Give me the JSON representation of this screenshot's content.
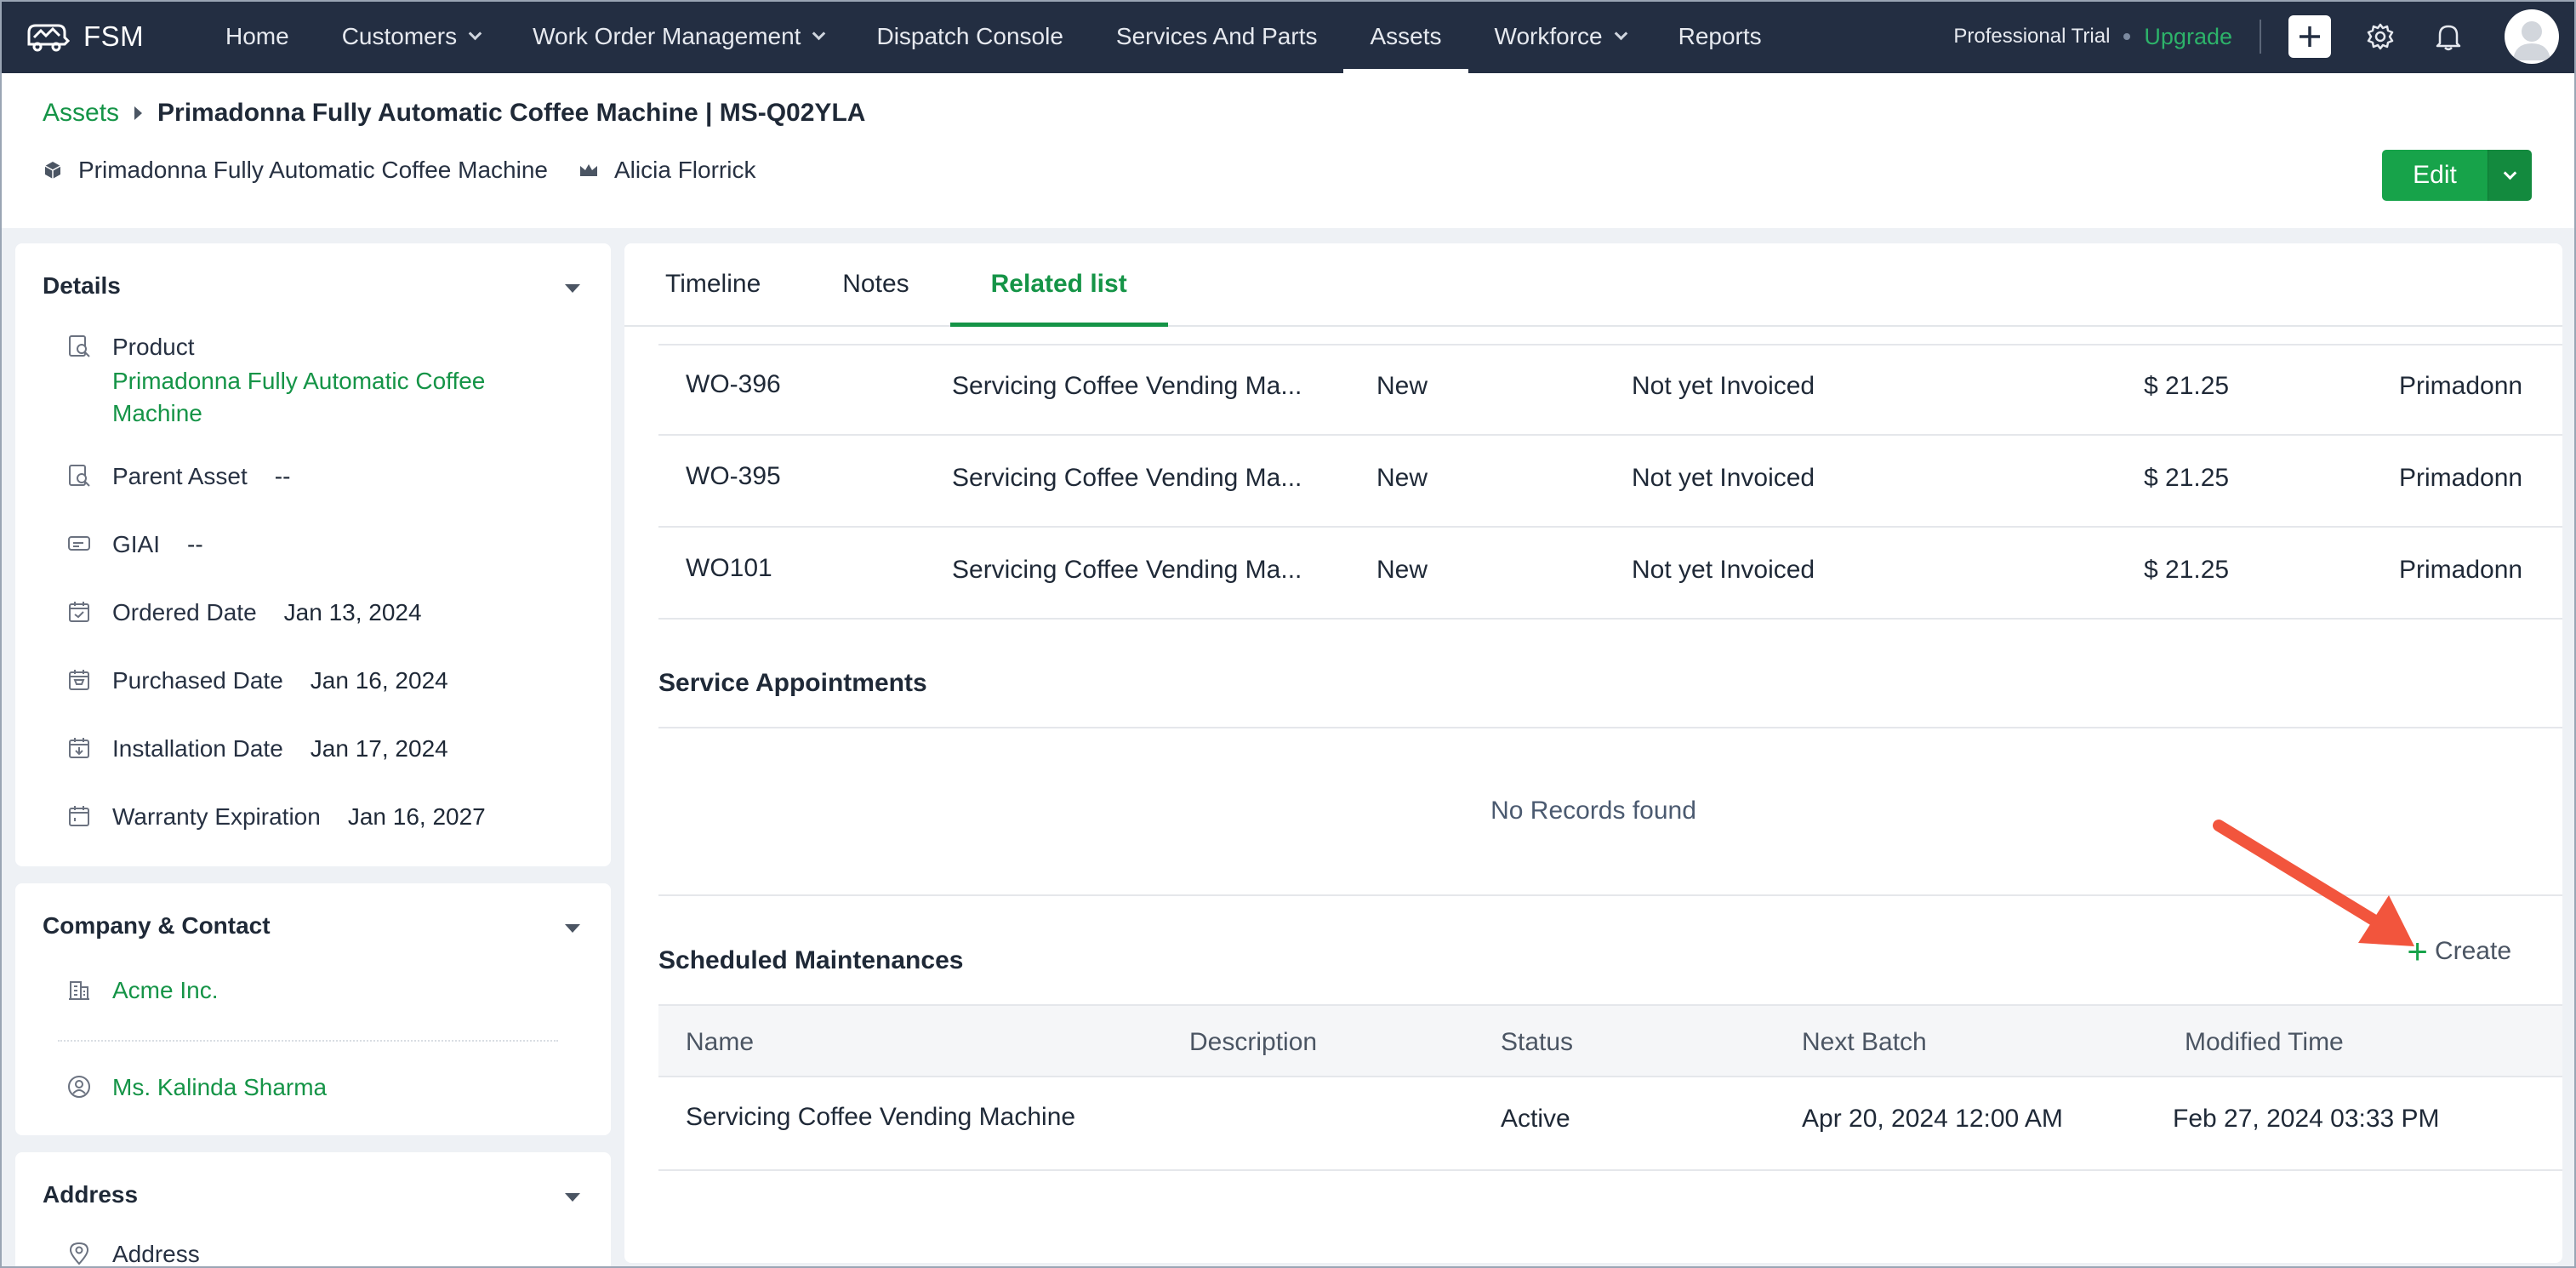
{
  "nav": {
    "brand": "FSM",
    "items": [
      {
        "label": "Home",
        "has_caret": false
      },
      {
        "label": "Customers",
        "has_caret": true
      },
      {
        "label": "Work Order Management",
        "has_caret": true
      },
      {
        "label": "Dispatch Console",
        "has_caret": false
      },
      {
        "label": "Services And Parts",
        "has_caret": false
      },
      {
        "label": "Assets",
        "has_caret": false,
        "active": true
      },
      {
        "label": "Workforce",
        "has_caret": true
      },
      {
        "label": "Reports",
        "has_caret": false
      }
    ],
    "trial_label": "Professional Trial",
    "upgrade_label": "Upgrade"
  },
  "header": {
    "breadcrumb_link": "Assets",
    "title": "Primadonna Fully Automatic Coffee Machine | MS-Q02YLA",
    "product": "Primadonna Fully Automatic Coffee Machine",
    "owner": "Alicia Florrick",
    "edit_label": "Edit"
  },
  "details": {
    "title": "Details",
    "product_label": "Product",
    "product_value_line1": "Primadonna Fully Automatic Coffee",
    "product_value_line2": "Machine",
    "parent_label": "Parent Asset",
    "parent_value": "--",
    "giai_label": "GIAI",
    "giai_value": "--",
    "ordered_label": "Ordered Date",
    "ordered_value": "Jan 13, 2024",
    "purchased_label": "Purchased Date",
    "purchased_value": "Jan 16, 2024",
    "installation_label": "Installation Date",
    "installation_value": "Jan 17, 2024",
    "warranty_label": "Warranty Expiration",
    "warranty_value": "Jan 16, 2027"
  },
  "company": {
    "title": "Company & Contact",
    "company_name": "Acme Inc.",
    "contact_name": "Ms. Kalinda Sharma"
  },
  "address": {
    "title": "Address",
    "label": "Address"
  },
  "tabs": {
    "timeline": "Timeline",
    "notes": "Notes",
    "related": "Related list"
  },
  "work_orders": [
    {
      "id": "WO-396",
      "summary": "Servicing Coffee Vending Ma...",
      "status": "New",
      "billing": "Not yet Invoiced",
      "amount": "$ 21.25",
      "asset": "Primadonn"
    },
    {
      "id": "WO-395",
      "summary": "Servicing Coffee Vending Ma...",
      "status": "New",
      "billing": "Not yet Invoiced",
      "amount": "$ 21.25",
      "asset": "Primadonn"
    },
    {
      "id": "WO101",
      "summary": "Servicing Coffee Vending Ma...",
      "status": "New",
      "billing": "Not yet Invoiced",
      "amount": "$ 21.25",
      "asset": "Primadonn"
    }
  ],
  "service_appointments": {
    "title": "Service Appointments",
    "empty": "No Records found"
  },
  "maintenances": {
    "title": "Scheduled Maintenances",
    "create_label": "Create",
    "columns": [
      "Name",
      "Description",
      "Status",
      "Next Batch",
      "Modified Time"
    ],
    "rows": [
      {
        "name": "Servicing Coffee Vending Machine",
        "description": "",
        "status": "Active",
        "next_batch": "Apr 20, 2024 12:00 AM",
        "modified": "Feb 27, 2024 03:33 PM"
      }
    ]
  },
  "colors": {
    "nav_bg": "#232e42",
    "accent_green": "#159447",
    "edit_green": "#17a34a",
    "annotation_arrow": "#f2553d"
  }
}
